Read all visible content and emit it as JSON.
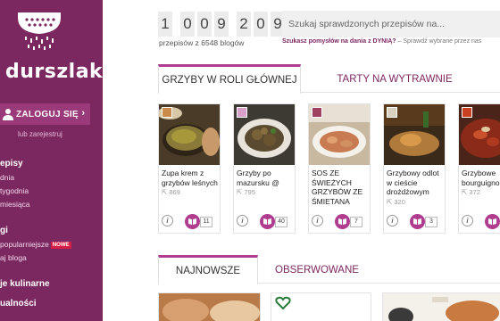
{
  "sidebar": {
    "logo_text": "durszlak",
    "login_label": "ZALOGUJ SIĘ",
    "register_label": "lub zarejestruj",
    "sections": [
      {
        "title": "episy",
        "items": [
          "dnia",
          "tygodnia",
          "miesiąca"
        ]
      },
      {
        "title": "gi",
        "items": [
          "popularniejsze",
          "aj bloga"
        ],
        "new_badge": "NOWE"
      },
      {
        "title": "je kulinarne",
        "items": []
      },
      {
        "title": "ualności",
        "items": []
      }
    ]
  },
  "counter": {
    "digits": [
      "1",
      "0",
      "0",
      "9",
      "2",
      "0",
      "9"
    ],
    "caption": "przepisów z 6548 blogów"
  },
  "search": {
    "placeholder": "Szukaj sprawdzonych przepisów na...",
    "promo_bold": "Szukasz pomysłów na dania z DYNIĄ?",
    "promo_rest": " – Sprawdź wybrane przez nas"
  },
  "tabs_top": [
    "GRZYBY W ROLI GŁÓWNEJ",
    "TARTY NA WYTRAWNIE"
  ],
  "tabs_bottom": [
    "NAJNOWSZE",
    "OBSERWOWANE"
  ],
  "cards": [
    {
      "title": "Zupa krem z grzybów leśnych",
      "likes": "869",
      "comments": "11",
      "photo": "soup"
    },
    {
      "title": "Grzyby po mazursku @",
      "likes": "795",
      "comments": "40",
      "photo": "mushrooms"
    },
    {
      "title": "SOS ZE ŚWIEŻYCH GRZYBÓW ZE ŚMIETANA",
      "likes": "",
      "comments": "7",
      "photo": "sauce"
    },
    {
      "title": "Grzybowy odlot w cieście drożdżowym",
      "likes": "320",
      "comments": "3",
      "photo": "pastry"
    },
    {
      "title": "Grzybowe bourguignon",
      "likes": "372",
      "comments": "",
      "photo": "stew"
    }
  ],
  "colors": {
    "brand": "#7c2860",
    "accent": "#b03c8f",
    "badge_new": "#d61f46"
  }
}
